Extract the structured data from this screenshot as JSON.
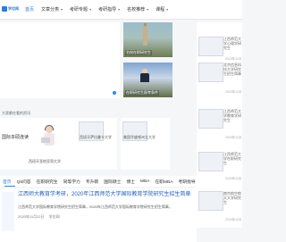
{
  "header": {
    "logo_text": "学位网",
    "logo_sub": "",
    "nav": [
      {
        "label": "首页",
        "has_chevron": false,
        "active": true
      },
      {
        "label": "文章分类",
        "has_chevron": true,
        "active": false
      },
      {
        "label": "考研专题",
        "has_chevron": true,
        "active": false
      },
      {
        "label": "考研指导",
        "has_chevron": true,
        "active": false
      },
      {
        "label": "名校推荐",
        "has_chevron": true,
        "active": false
      },
      {
        "label": "课程",
        "has_chevron": true,
        "active": false
      }
    ]
  },
  "hero": {
    "caption_1": "名校在职研究生",
    "caption_2": "在职研究生报考条件"
  },
  "sidebar": {
    "items": [
      {
        "title": "江西师范大学心理学研究生",
        "date": "2020年11月"
      },
      {
        "title": "北京信息科技大学研究生招生简章",
        "date": "2020年11月"
      },
      {
        "title": "江西师范大学教育学研究生",
        "date": "2020年11月"
      },
      {
        "title": "江西师范大学在职研究生",
        "date": "2020年11月"
      },
      {
        "title": "南京航空航天大学研究生",
        "date": "2020年11月"
      }
    ]
  },
  "section": {
    "label": "大家都在看的资讯",
    "featured_title": "国际本硕连读"
  },
  "cards": [
    {
      "caption": "西班牙圣地亚哥大学"
    },
    {
      "caption": "西班牙萨拉曼卡大学"
    },
    {
      "caption": "美国华盛顿州立大学"
    }
  ],
  "tabs": [
    "首页",
    "Q9问答",
    "在职研究生",
    "同等学力",
    "专升硕",
    "国际硕士",
    "博士",
    "MBA",
    "在职MBA",
    "考研指导"
  ],
  "article": {
    "title": "江西师大教育学考研，2020年江西师范大学国际教育学院研究生招生简章",
    "desc": "江西师范大学国际教育学院研究生招生简章，2020年江西师范大学国际教育学院研究生招生简章。",
    "date": "2020年11月22日",
    "source": "学位网"
  }
}
